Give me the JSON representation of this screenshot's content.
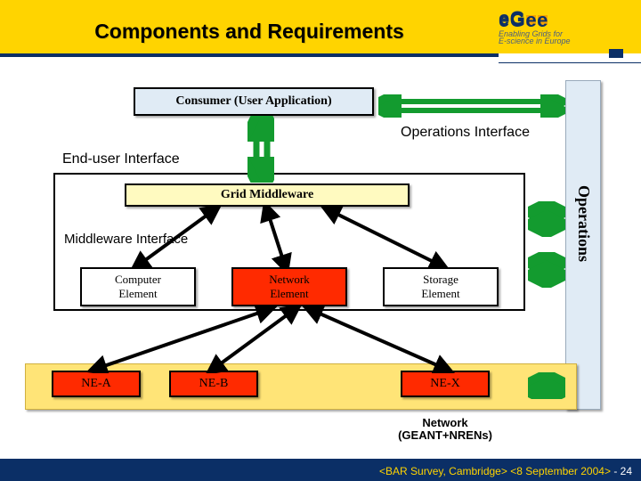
{
  "title": "Components and Requirements",
  "logo": {
    "main": "eGee",
    "sub1": "Enabling Grids for",
    "sub2": "E-science in Europe"
  },
  "consumer_label": "Consumer (User Application)",
  "ops_interface": "Operations Interface",
  "end_user_interface": "End-user Interface",
  "grid_middleware": "Grid Middleware",
  "middleware_interface": "Middleware Interface",
  "elements": {
    "computer": "Computer\nElement",
    "network": "Network\nElement",
    "storage": "Storage\nElement"
  },
  "ne": {
    "a": "NE-A",
    "b": "NE-B",
    "x": "NE-X"
  },
  "network_label": "Network\n(GEANT+NRENs)",
  "operations": "Operations",
  "footer": {
    "venue": "<BAR Survey, Cambridge>",
    "date": "<8 September 2004>",
    "page": "- 24"
  }
}
